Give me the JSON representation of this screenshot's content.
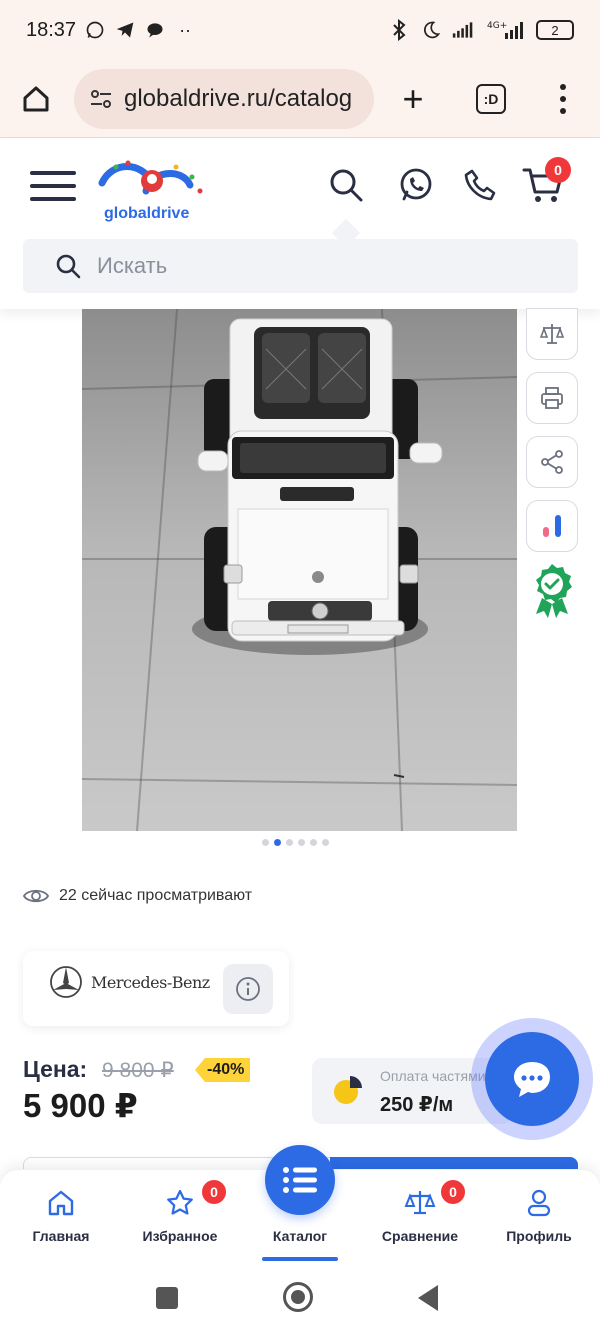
{
  "status_bar": {
    "time": "18:37",
    "network": "4G+",
    "battery": "2"
  },
  "browser": {
    "url": "globaldrive.ru/catalog",
    "tabs_count": ":D"
  },
  "header": {
    "logo_text": "globaldrive",
    "cart_count": "0",
    "search_placeholder": "Искать"
  },
  "gallery": {
    "slide_count": 6,
    "active_slide": 2
  },
  "viewers": {
    "text": "22 сейчас просматривают"
  },
  "brand": {
    "name": "Mercedes-Benz"
  },
  "pricing": {
    "label": "Цена:",
    "old_price": "9 800 ₽",
    "discount": "-40%",
    "price": "5 900 ₽",
    "installment_label": "Оплата частями",
    "installment_amount": "250 ₽/м"
  },
  "bottom_nav": {
    "items": [
      {
        "label": "Главная",
        "icon": "home-icon"
      },
      {
        "label": "Избранное",
        "icon": "star-icon",
        "badge": "0"
      },
      {
        "label": "Каталог",
        "icon": "list-icon"
      },
      {
        "label": "Сравнение",
        "icon": "scales-icon",
        "badge": "0"
      },
      {
        "label": "Профиль",
        "icon": "user-icon"
      }
    ]
  },
  "colors": {
    "accent": "#2d6be4",
    "badge": "#f0383b",
    "discount": "#ffd43a",
    "browser_bg": "#fcf2ee"
  }
}
